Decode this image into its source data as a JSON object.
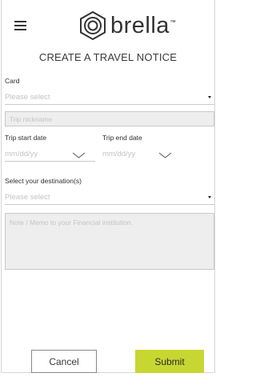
{
  "header": {
    "logo_text": "brella",
    "logo_tm": "™"
  },
  "page": {
    "title": "CREATE A TRAVEL NOTICE"
  },
  "form": {
    "card": {
      "label": "Card",
      "placeholder": "Please select"
    },
    "nickname": {
      "placeholder": "Trip nickname"
    },
    "start_date": {
      "label": "Trip start date",
      "placeholder": "mm/dd/yy"
    },
    "end_date": {
      "label": "Trip end date",
      "placeholder": "mm/dd/yy"
    },
    "destination": {
      "label": "Select your destination(s)",
      "placeholder": "Please select"
    },
    "memo": {
      "placeholder": "Note / Memo to your Financial institution."
    }
  },
  "actions": {
    "cancel_label": "Cancel",
    "submit_label": "Submit"
  },
  "colors": {
    "submit_bg": "#c8d632",
    "field_bg": "#eeeeee"
  }
}
